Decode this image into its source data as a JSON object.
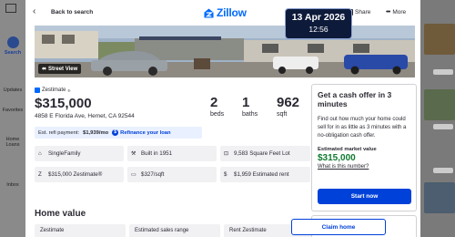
{
  "app": {
    "sidebar": {
      "search_label": "Search",
      "updates_label": "Updates",
      "favorites_label": "Favorites",
      "loans_label": "Home Loans",
      "inbox_label": "Inbox"
    }
  },
  "header": {
    "back_label": "Back to search",
    "logo_text": "Zillow",
    "share_label": "Share",
    "more_label": "More"
  },
  "clock": {
    "date": "13 Apr 2026",
    "time": "12:56"
  },
  "photo": {
    "street_view_label": "Street View"
  },
  "listing": {
    "zestimate_tag": "Zestimate",
    "zestimate_sup": "®",
    "price": "$315,000",
    "address": "4858 E Florida Ave, Hemet, CA 92544",
    "beds": "2",
    "beds_label": "beds",
    "baths": "1",
    "baths_label": "baths",
    "sqft": "962",
    "sqft_label": "sqft",
    "refi_prefix": "Est. refi payment:",
    "refi_value": "$1,939/mo",
    "refi_link": "Refinance your loan"
  },
  "facts": [
    {
      "icon": "home-icon",
      "text": "SingleFamily"
    },
    {
      "icon": "hammer-icon",
      "text": "Built in 1951"
    },
    {
      "icon": "lot-icon",
      "text": "9,583 Square Feet Lot"
    },
    {
      "icon": "zestimate-icon",
      "text": "$315,000 Zestimate®"
    },
    {
      "icon": "ruler-icon",
      "text": "$327/sqft"
    },
    {
      "icon": "dollar-icon",
      "text": "$1,959 Estimated rent"
    }
  ],
  "home_value": {
    "title": "Home value",
    "cards": [
      "Zestimate",
      "Estimated sales range",
      "Rent Zestimate"
    ]
  },
  "cash_offer": {
    "title": "Get a cash offer in 3 minutes",
    "description": "Find out how much your home could sell for in as little as 3 minutes with a no-obligation cash offer.",
    "est_label": "Estimated market value",
    "est_value": "$315,000",
    "what_link": "What is this number?",
    "start_button": "Start now",
    "claim_button": "Claim home"
  },
  "colors": {
    "brand_blue": "#006aff",
    "button_blue": "#0041d9",
    "value_green": "#0d7a2e"
  }
}
